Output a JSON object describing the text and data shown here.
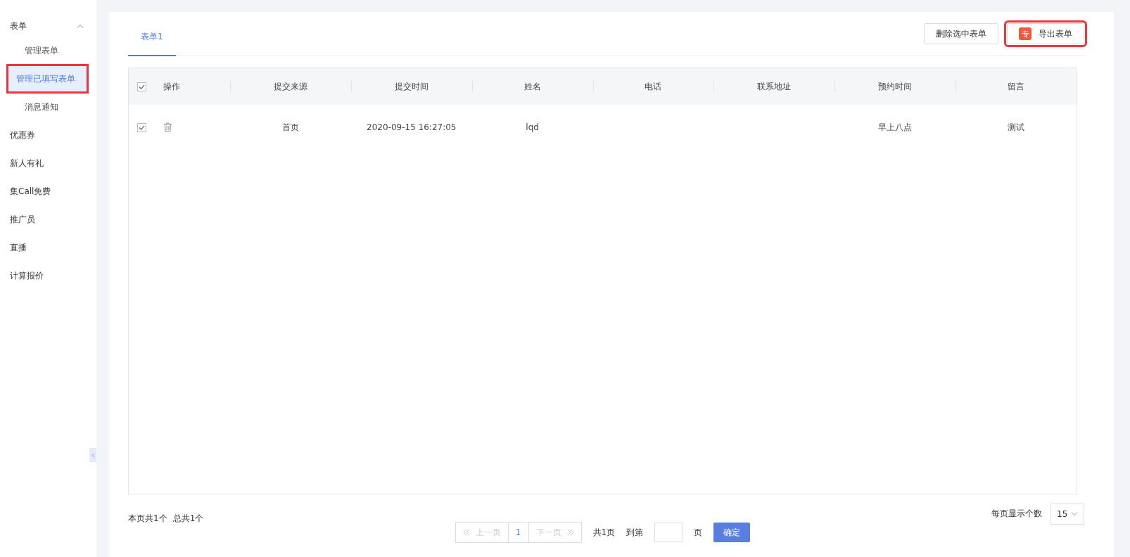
{
  "sidebar": {
    "items": [
      {
        "label": "表单",
        "expanded": true,
        "children": [
          {
            "label": "管理表单",
            "selected": false,
            "highlighted": false
          },
          {
            "label": "管理已填写表单",
            "selected": true,
            "highlighted": true
          },
          {
            "label": "消息通知",
            "selected": false,
            "highlighted": false
          }
        ]
      },
      {
        "label": "优惠券"
      },
      {
        "label": "新人有礼"
      },
      {
        "label": "集Call免费"
      },
      {
        "label": "推广员"
      },
      {
        "label": "直播"
      },
      {
        "label": "计算报价"
      }
    ]
  },
  "tabs": [
    {
      "label": "表单1",
      "selected": true
    }
  ],
  "actions": [
    {
      "label": "删除选中表单",
      "highlighted": false
    },
    {
      "label": "导出表单",
      "badge": "专",
      "highlighted": true
    }
  ],
  "table": {
    "all_checked": true,
    "columns": [
      "操作",
      "提交来源",
      "提交时间",
      "姓名",
      "电话",
      "联系地址",
      "预约时间",
      "留言"
    ],
    "rows": [
      {
        "checked": true,
        "cells": [
          "",
          "首页",
          "2020-09-15 16:27:05",
          "lqd",
          "",
          "",
          "早上八点",
          "测试"
        ]
      }
    ]
  },
  "footer": {
    "page_count": "本页共1个",
    "total": "总共1个",
    "per_page_label": "每页显示个数",
    "per_page": "15"
  },
  "pagination": {
    "prev": "上一页",
    "pages": [
      {
        "label": "1",
        "selected": true
      }
    ],
    "next": "下一页",
    "total_pages": "共1页",
    "goto_label": "到第",
    "page_unit": "页",
    "confirm": "确定"
  }
}
